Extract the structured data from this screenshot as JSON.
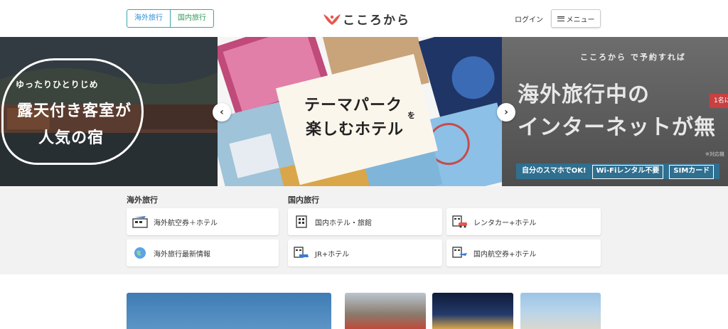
{
  "header": {
    "tab_overseas": "海外旅行",
    "tab_domestic": "国内旅行",
    "logo_text": "こころから",
    "login": "ログイン",
    "menu": "メニュー"
  },
  "carousel": {
    "left": {
      "tagline": "ゆったりひとりじめ",
      "line1": "露天付き客室が",
      "line2": "人気の宿"
    },
    "center": {
      "line1": "テーマパーク",
      "particle": "を",
      "line2": "楽しむホテル"
    },
    "right": {
      "brand": "こころから で予約すれば",
      "line1": "海外旅行中の",
      "line2": "インターネットが無",
      "badge": "1名に",
      "note": "※対応機",
      "bar_text": "自分のスマホでOK!",
      "bar_box1": "Wi-Fiレンタル不要",
      "bar_box2": "SIMカード"
    }
  },
  "sections": {
    "overseas": {
      "title": "海外旅行",
      "items": [
        "海外航空券＋ホテル",
        "海外旅行最新情報"
      ]
    },
    "domestic": {
      "title": "国内旅行",
      "items": [
        "国内ホテル・旅館",
        "レンタカー+ホテル",
        "JR+ホテル",
        "国内航空券+ホテル"
      ]
    }
  },
  "colors": {
    "accent": "#e8554d",
    "overseas_tab": "#2b8fd6",
    "domestic_tab": "#2e9a5a",
    "tab_border": "#3aa7a1"
  }
}
